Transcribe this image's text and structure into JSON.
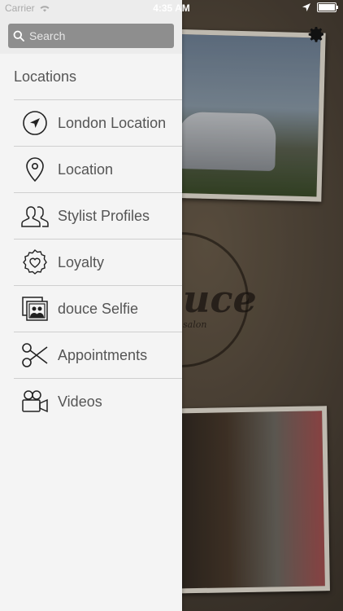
{
  "status_bar": {
    "carrier": "Carrier",
    "time": "4:35 AM"
  },
  "search": {
    "placeholder": "Search"
  },
  "drawer": {
    "section_title": "Locations",
    "items": [
      {
        "label": "London Location",
        "icon": "navigation-arrow-icon"
      },
      {
        "label": "Location",
        "icon": "map-pin-icon"
      },
      {
        "label": "Stylist Profiles",
        "icon": "people-icon"
      },
      {
        "label": "Loyalty",
        "icon": "heart-badge-icon"
      },
      {
        "label": "douce Selfie",
        "icon": "photo-stack-icon"
      },
      {
        "label": "Appointments",
        "icon": "scissors-icon"
      },
      {
        "label": "Videos",
        "icon": "video-camera-icon"
      }
    ]
  },
  "background": {
    "logo_text": "uce",
    "logo_subtext": "salon"
  },
  "colors": {
    "drawer_bg": "#f4f4f4",
    "search_bg": "#8e8e8e",
    "text": "#555555"
  }
}
